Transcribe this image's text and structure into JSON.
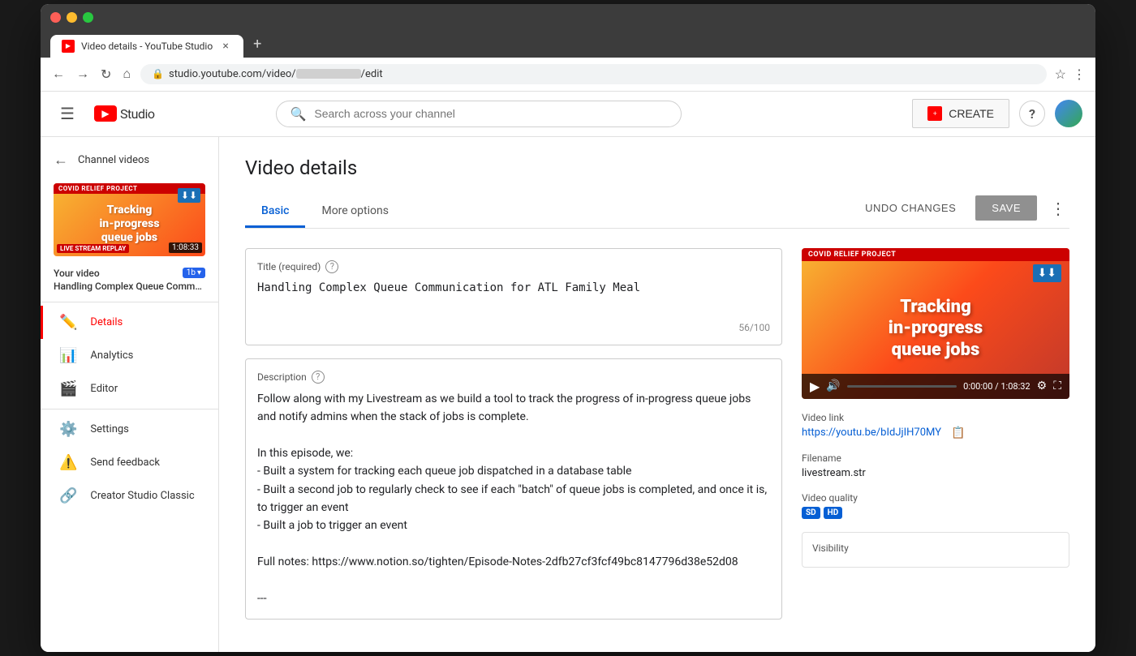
{
  "browser": {
    "tab_title": "Video details - YouTube Studio",
    "tab_plus": "+",
    "address": "studio.youtube.com/video/",
    "address_suffix": "/edit"
  },
  "header": {
    "menu_icon": "☰",
    "logo_text": "Studio",
    "search_placeholder": "Search across your channel",
    "create_label": "CREATE",
    "help_icon": "?",
    "avatar_initials": ""
  },
  "sidebar": {
    "back_label": "Channel videos",
    "your_video_label": "Your video",
    "video_title": "Handling Complex Queue Communi...",
    "covid_banner": "COVID RELIEF PROJECT",
    "video_thumb_text": "Tracking in-progress queue jobs",
    "duration": "1:08:33",
    "livestream_badge": "LIVE STREAM REPLAY",
    "channel_badge": "1b",
    "items": [
      {
        "id": "details",
        "label": "Details",
        "icon": "✏️",
        "active": true
      },
      {
        "id": "analytics",
        "label": "Analytics",
        "icon": "📊",
        "active": false
      },
      {
        "id": "editor",
        "label": "Editor",
        "icon": "🎬",
        "active": false
      },
      {
        "id": "settings",
        "label": "Settings",
        "icon": "⚙️",
        "active": false
      },
      {
        "id": "send-feedback",
        "label": "Send feedback",
        "icon": "⚠️",
        "active": false
      },
      {
        "id": "creator-studio",
        "label": "Creator Studio Classic",
        "icon": "🔗",
        "active": false
      }
    ]
  },
  "content": {
    "page_title": "Video details",
    "tabs": [
      {
        "id": "basic",
        "label": "Basic",
        "active": true
      },
      {
        "id": "more-options",
        "label": "More options",
        "active": false
      }
    ],
    "undo_label": "UNDO CHANGES",
    "save_label": "SAVE",
    "title_field": {
      "label": "Title (required)",
      "value": "Handling Complex Queue Communication for ATL Family Meal",
      "counter": "56/100"
    },
    "description_field": {
      "label": "Description",
      "value": "Follow along with my Livestream as we build a tool to track the progress of in-progress queue jobs and notify admins when the stack of jobs is complete.\n\nIn this episode, we:\n- Built a system for tracking each queue job dispatched in a database table\n- Built a second job to regularly check to see if each \"batch\" of queue jobs is completed, and once it is, to trigger an event\n- Built a job to trigger an event\n\nFull notes: https://www.notion.so/tighten/Episode-Notes-2dfb27cf3fcf49bc8147796d38e52d08\n\n---"
    }
  },
  "preview": {
    "covid_banner": "COVID RELIEF PROJECT",
    "thumb_text": "Tracking in-progress queue jobs",
    "time_display": "0:00:00 / 1:08:32",
    "video_link_label": "Video link",
    "video_link": "https://youtu.be/bIdJjIH70MY",
    "filename_label": "Filename",
    "filename": "livestream.str",
    "quality_label": "Video quality",
    "qualities": [
      "SD",
      "HD"
    ],
    "visibility_label": "Visibility"
  }
}
